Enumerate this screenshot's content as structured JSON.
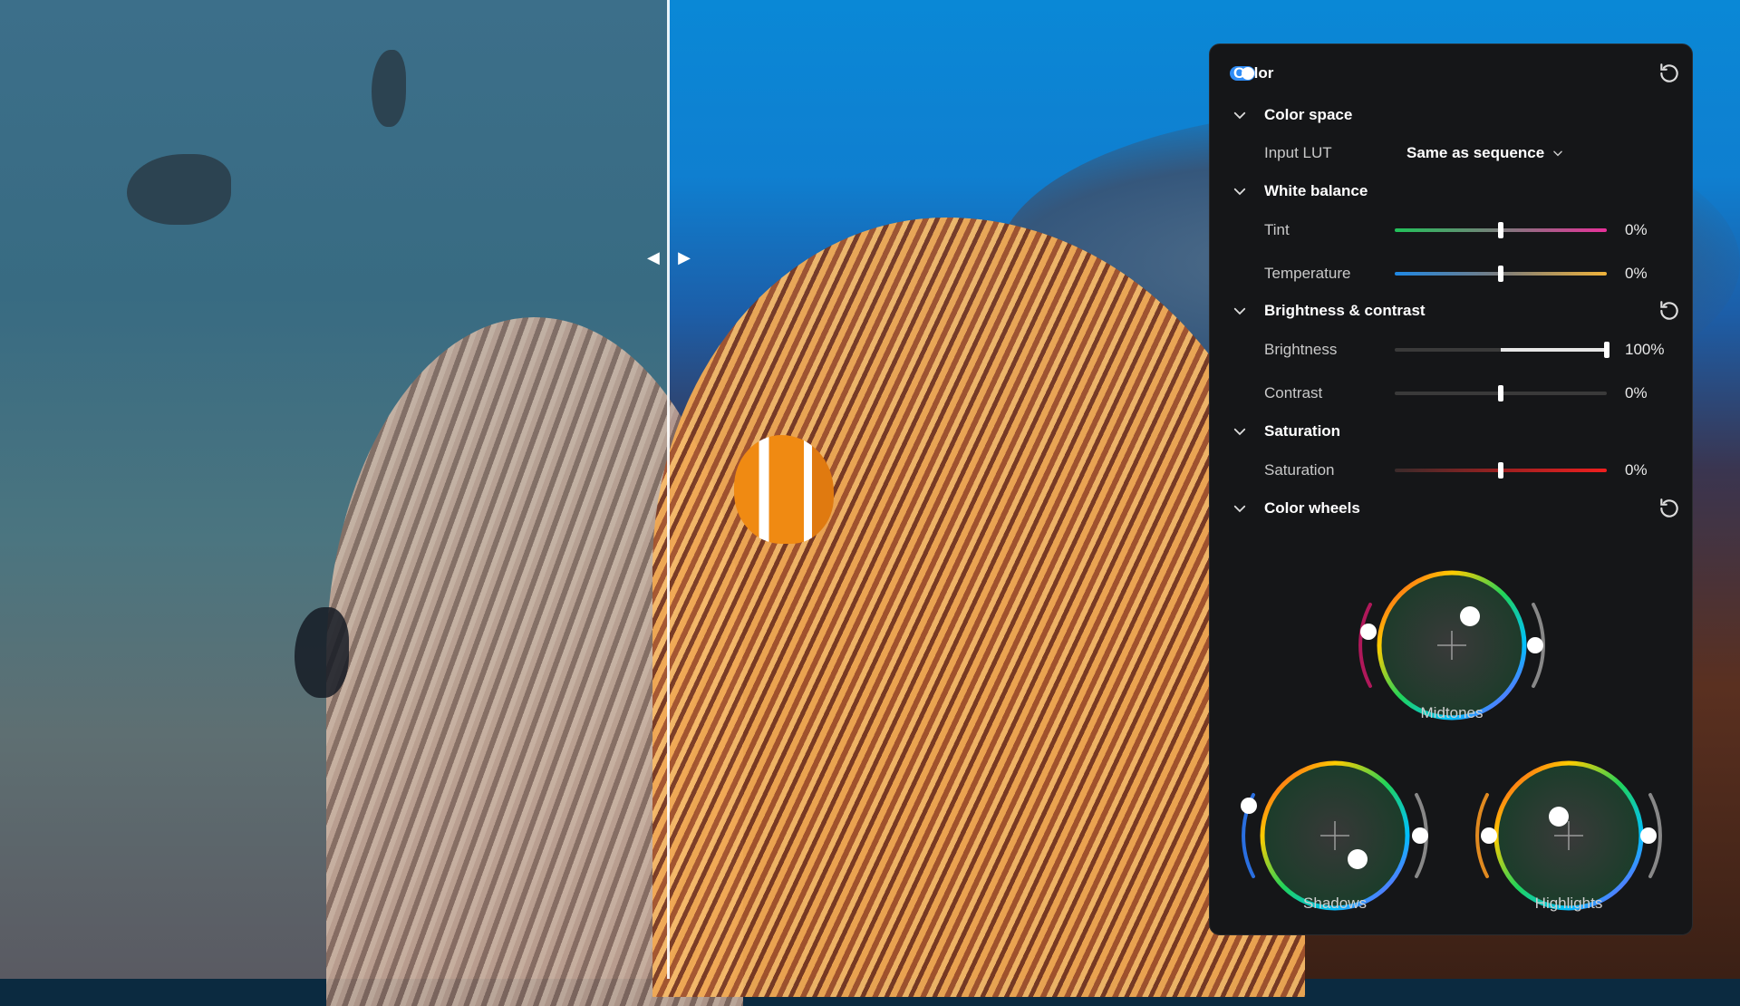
{
  "panel": {
    "title": "Color",
    "enabled": true,
    "sections": {
      "color_space": {
        "title": "Color space",
        "input_lut_label": "Input LUT",
        "input_lut_value": "Same as sequence"
      },
      "white_balance": {
        "title": "White balance",
        "tint_label": "Tint",
        "tint_value": "0%",
        "tint_level": 0.5,
        "temperature_label": "Temperature",
        "temperature_value": "0%",
        "temperature_level": 0.5
      },
      "brightness_contrast": {
        "title": "Brightness & contrast",
        "brightness_label": "Brightness",
        "brightness_value": "100%",
        "brightness_level": 1.0,
        "contrast_label": "Contrast",
        "contrast_value": "0%",
        "contrast_level": 0.5
      },
      "saturation": {
        "title": "Saturation",
        "saturation_label": "Saturation",
        "saturation_value": "0%",
        "saturation_level": 0.5
      },
      "color_wheels": {
        "title": "Color wheels",
        "midtones_label": "Midtones",
        "shadows_label": "Shadows",
        "highlights_label": "Highlights"
      }
    }
  },
  "colors": {
    "accent": "#2f8cf5",
    "panel_bg": "#151618"
  },
  "icons": {
    "reset": "reset-icon",
    "chevron": "chevron-down-icon",
    "compare_handle": "compare-arrows-icon"
  }
}
